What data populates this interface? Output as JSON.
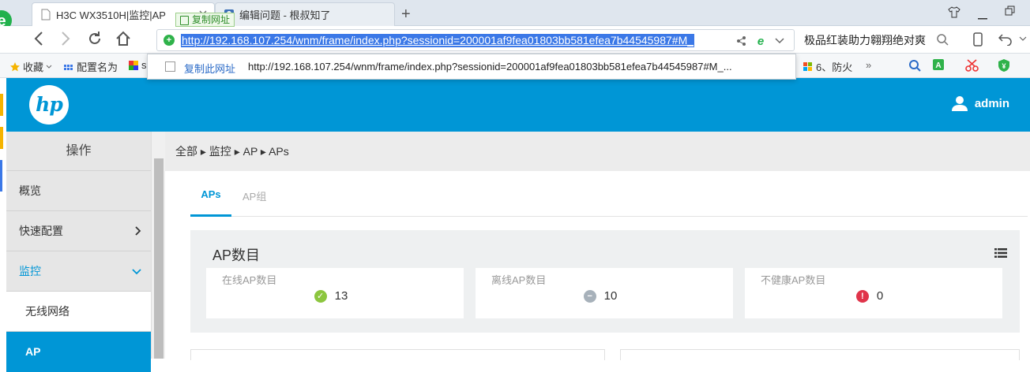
{
  "browser": {
    "tabs": [
      {
        "title": "H3C WX3510H|监控|AP"
      },
      {
        "title": "编辑问题 - 根叔知了"
      }
    ],
    "url": "http://192.168.107.254/wnm/frame/index.php?sessionid=200001af9fea01803bb581efea7b44545987#M_",
    "copy_tip": "复制网址",
    "search_text": "极品红装助力翱翔绝对爽",
    "bookmarks": [
      {
        "label": "收藏"
      },
      {
        "label": "配置名为"
      },
      {
        "label": "s"
      },
      {
        "label": "6、防火"
      }
    ],
    "copy_popup": {
      "label": "复制此网址",
      "url": "http://192.168.107.254/wnm/frame/index.php?sessionid=200001af9fea01803bb581efea7b44545987#M_..."
    }
  },
  "app": {
    "logo": "hp",
    "user": "admin",
    "sidebar": {
      "header": "操作",
      "items": [
        {
          "label": "概览"
        },
        {
          "label": "快速配置"
        },
        {
          "label": "监控"
        },
        {
          "label": "无线网络"
        },
        {
          "label": "AP"
        }
      ]
    },
    "breadcrumb": "全部 ▸ 监控 ▸ AP ▸ APs",
    "tabs": [
      {
        "label": "APs"
      },
      {
        "label": "AP组"
      }
    ],
    "panel": {
      "title": "AP数目",
      "cards": [
        {
          "label": "在线AP数目",
          "value": "13",
          "status": "online",
          "color": "#8cc63f"
        },
        {
          "label": "离线AP数目",
          "value": "10",
          "status": "offline",
          "color": "#a7b1ba"
        },
        {
          "label": "不健康AP数目",
          "value": "0",
          "status": "unhealthy",
          "color": "#e0344a"
        }
      ]
    },
    "colors": {
      "brand": "#0096d6"
    }
  }
}
